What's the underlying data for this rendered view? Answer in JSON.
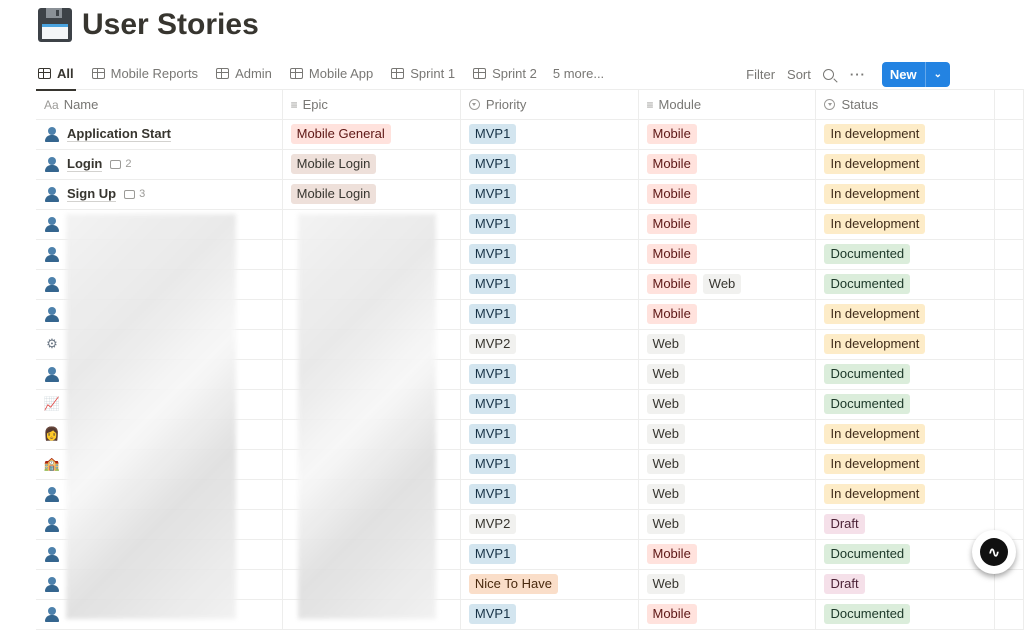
{
  "page": {
    "title": "User Stories",
    "icon": "floppy-disk-icon"
  },
  "tabs": [
    {
      "label": "All",
      "active": true
    },
    {
      "label": "Mobile Reports"
    },
    {
      "label": "Admin"
    },
    {
      "label": "Mobile App"
    },
    {
      "label": "Sprint 1"
    },
    {
      "label": "Sprint 2"
    }
  ],
  "tabs_more": "5 more...",
  "toolbar": {
    "filter": "Filter",
    "sort": "Sort",
    "new": "New"
  },
  "columns": [
    {
      "label": "Name",
      "icon": "Aa"
    },
    {
      "label": "Epic",
      "icon": "list-icon"
    },
    {
      "label": "Priority",
      "icon": "select-icon"
    },
    {
      "label": "Module",
      "icon": "list-icon"
    },
    {
      "label": "Status",
      "icon": "select-icon"
    }
  ],
  "colors": {
    "Mobile General": {
      "bg": "#ffe2dd",
      "fg": "#5d1715"
    },
    "Mobile Login": {
      "bg": "#eee0da",
      "fg": "#37352f"
    },
    "MVP1": {
      "bg": "#d3e5ef",
      "fg": "#183347"
    },
    "MVP2": {
      "bg": "#f1f1ef",
      "fg": "#37352f"
    },
    "Nice To Have": {
      "bg": "#fadec9",
      "fg": "#49290e"
    },
    "Mobile": {
      "bg": "#ffe2dd",
      "fg": "#5d1715"
    },
    "Web": {
      "bg": "#f1f1ef",
      "fg": "#37352f"
    },
    "In development": {
      "bg": "#fdecc8",
      "fg": "#402c1b"
    },
    "Documented": {
      "bg": "#dbeddb",
      "fg": "#1c3829"
    },
    "Draft": {
      "bg": "#f5e0e9",
      "fg": "#4c2337"
    }
  },
  "rows": [
    {
      "icon": "person",
      "name": "Application Start",
      "comments": null,
      "epic": [
        "Mobile General"
      ],
      "priority": "MVP1",
      "module": [
        "Mobile"
      ],
      "status": "In development"
    },
    {
      "icon": "person",
      "name": "Login",
      "comments": "2",
      "epic": [
        "Mobile Login"
      ],
      "priority": "MVP1",
      "module": [
        "Mobile"
      ],
      "status": "In development"
    },
    {
      "icon": "person",
      "name": "Sign Up",
      "comments": "3",
      "epic": [
        "Mobile Login"
      ],
      "priority": "MVP1",
      "module": [
        "Mobile"
      ],
      "status": "In development"
    },
    {
      "icon": "person",
      "name": "",
      "epic": [],
      "priority": "MVP1",
      "module": [
        "Mobile"
      ],
      "status": "In development"
    },
    {
      "icon": "person",
      "name": "",
      "epic": [],
      "priority": "MVP1",
      "module": [
        "Mobile"
      ],
      "status": "Documented"
    },
    {
      "icon": "person",
      "name": "",
      "epic": [],
      "priority": "MVP1",
      "module": [
        "Mobile",
        "Web"
      ],
      "status": "Documented"
    },
    {
      "icon": "person",
      "name": "",
      "epic": [],
      "priority": "MVP1",
      "module": [
        "Mobile"
      ],
      "status": "In development"
    },
    {
      "icon": "gear",
      "name": "",
      "epic": [],
      "priority": "MVP2",
      "module": [
        "Web"
      ],
      "status": "In development"
    },
    {
      "icon": "person",
      "name": "",
      "epic": [],
      "priority": "MVP1",
      "module": [
        "Web"
      ],
      "status": "Documented"
    },
    {
      "icon": "chart",
      "name": "",
      "epic": [],
      "priority": "MVP1",
      "module": [
        "Web"
      ],
      "status": "Documented"
    },
    {
      "icon": "technologist",
      "name": "",
      "epic": [],
      "priority": "MVP1",
      "module": [
        "Web"
      ],
      "status": "In development"
    },
    {
      "icon": "school",
      "name": "",
      "epic": [],
      "priority": "MVP1",
      "module": [
        "Web"
      ],
      "status": "In development"
    },
    {
      "icon": "person",
      "name": "",
      "epic": [],
      "priority": "MVP1",
      "module": [
        "Web"
      ],
      "status": "In development"
    },
    {
      "icon": "person",
      "name": "",
      "epic": [],
      "priority": "MVP2",
      "module": [
        "Web"
      ],
      "status": "Draft"
    },
    {
      "icon": "person",
      "name": "",
      "epic": [],
      "priority": "MVP1",
      "module": [
        "Mobile"
      ],
      "status": "Documented"
    },
    {
      "icon": "person",
      "name": "",
      "epic": [],
      "priority": "Nice To Have",
      "module": [
        "Web"
      ],
      "status": "Draft"
    },
    {
      "icon": "person",
      "name": "",
      "epic": [],
      "priority": "MVP1",
      "module": [
        "Mobile"
      ],
      "status": "Documented"
    }
  ]
}
